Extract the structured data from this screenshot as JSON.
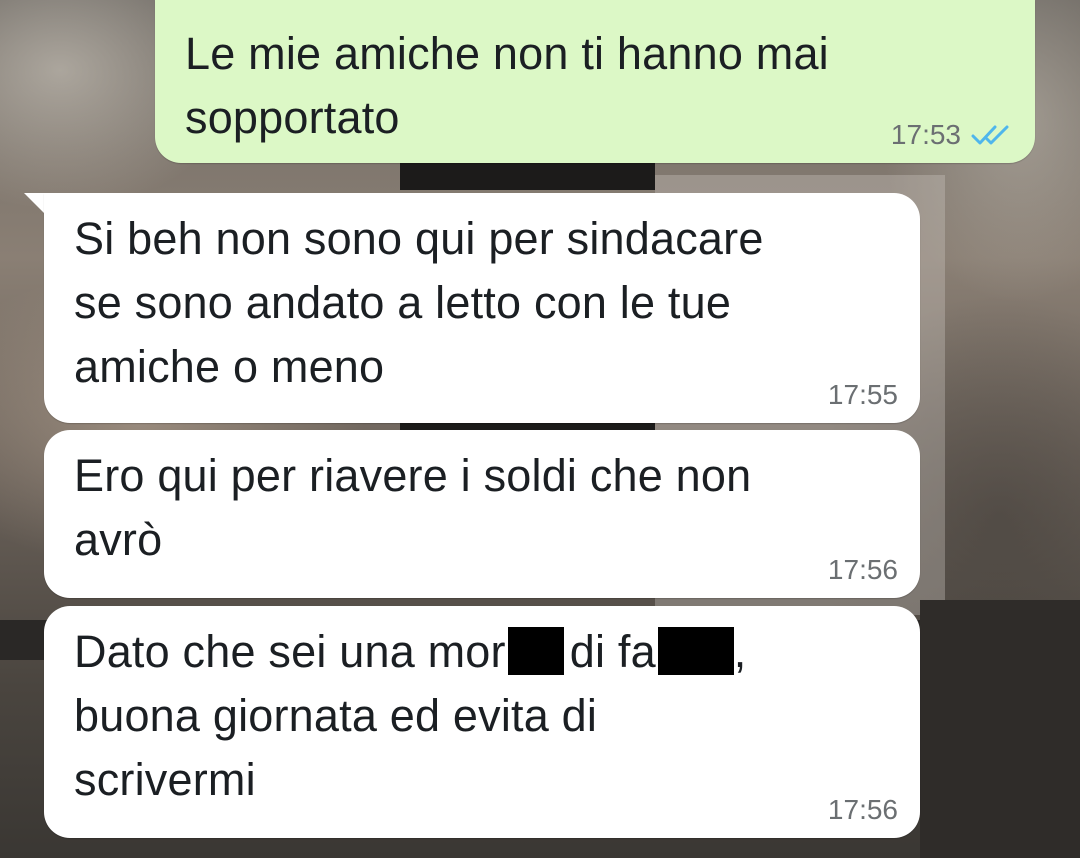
{
  "colors": {
    "outgoing_bubble": "#dcf8c6",
    "incoming_bubble": "#ffffff",
    "read_ticks": "#4fb6ec",
    "timestamp": "#6b6f72",
    "redaction": "#000000"
  },
  "messages": [
    {
      "direction": "outgoing",
      "text": "Le mie amiche non ti hanno mai\nsopportato",
      "time": "17:53",
      "status_icon": "double-check-read-icon"
    },
    {
      "direction": "incoming",
      "text": "Si beh non sono qui per sindacare\nse sono andato a letto con le tue\namiche o meno",
      "time": "17:55"
    },
    {
      "direction": "incoming",
      "text": "Ero qui per riavere i soldi che non\navrò",
      "time": "17:56"
    },
    {
      "direction": "incoming",
      "text_parts": [
        "Dato che sei una mor",
        "di fa",
        ","
      ],
      "text_rest": "\nbuona giornata ed evita di\nscrivermi",
      "redacted_segments": 2,
      "time": "17:56"
    }
  ]
}
